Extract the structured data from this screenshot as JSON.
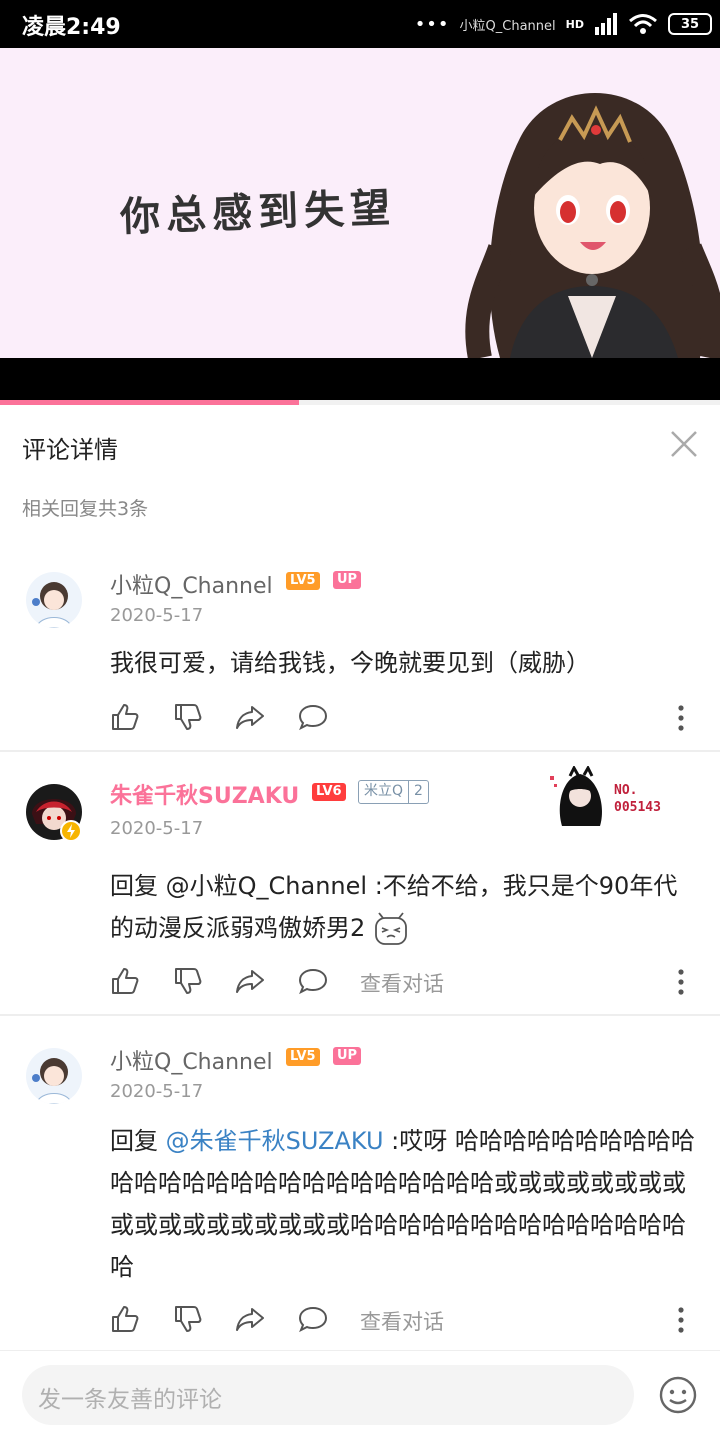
{
  "status_bar": {
    "time": "凌晨2:49",
    "dots": "•••",
    "notification": "小粒Q_Channel",
    "network": "HD",
    "battery": "35"
  },
  "video": {
    "subtitle": "你总感到失望",
    "progress": 0.415,
    "accent": "#fb7299"
  },
  "panel": {
    "title": "评论详情",
    "reply_count": "相关回复共3条"
  },
  "comments": [
    {
      "user": "小粒Q_Channel",
      "level": "LV5",
      "up_badge": "UP",
      "date": "2020-5-17",
      "text": "我很可爱，请给我钱，今晚就要见到（威胁）"
    },
    {
      "user": "朱雀千秋SUZAKU",
      "level": "LV6",
      "medal_name": "米立Q",
      "medal_level": "2",
      "decoration_no": "NO.",
      "decoration_id": "005143",
      "date": "2020-5-17",
      "reply_prefix": "回复 ",
      "mention": "@小粒Q_Channel",
      "text": " :不给不给，我只是个90年代的动漫反派弱鸡傲娇男2",
      "view_conversation": "查看对话"
    },
    {
      "user": "小粒Q_Channel",
      "level": "LV5",
      "up_badge": "UP",
      "date": "2020-5-17",
      "reply_prefix": "回复 ",
      "mention": "@朱雀千秋SUZAKU",
      "text": " :哎呀  哈哈哈哈哈哈哈哈哈哈哈哈哈哈哈哈哈哈哈哈哈哈哈哈哈哈或或或或或或或或或或或或或或或或或或哈哈哈哈哈哈哈哈哈哈哈哈哈哈哈",
      "view_conversation": "查看对话"
    }
  ],
  "input": {
    "placeholder": "发一条友善的评论"
  },
  "icons": [
    "like-icon",
    "dislike-icon",
    "share-icon",
    "reply-icon",
    "more-icon",
    "close-icon",
    "emoji-icon"
  ]
}
